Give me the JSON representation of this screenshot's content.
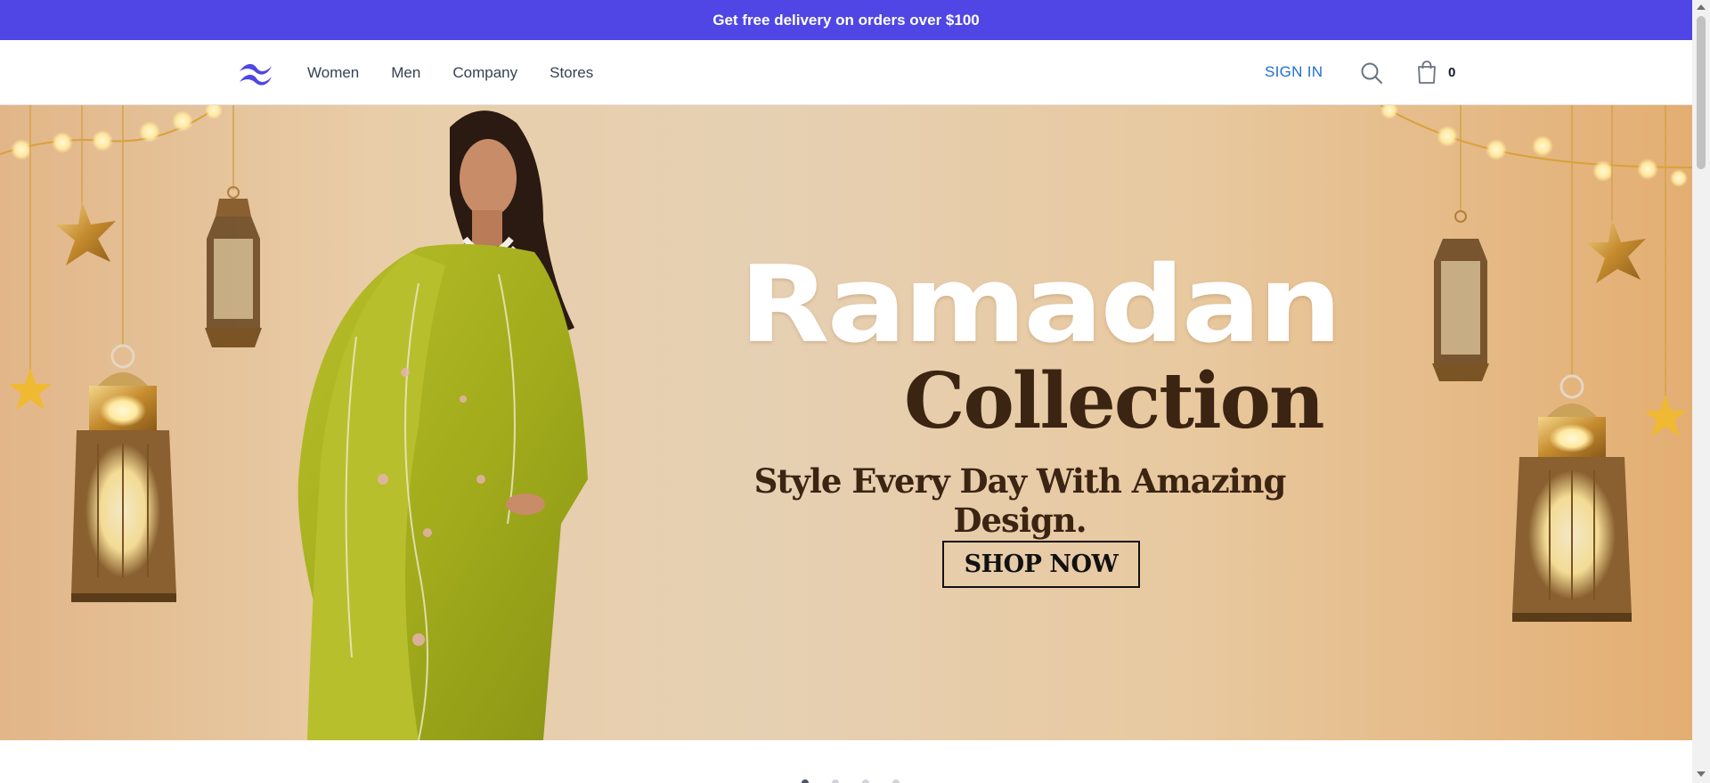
{
  "announcement": {
    "text": "Get free delivery on orders over $100"
  },
  "nav": {
    "logo": "wave-logo-icon",
    "links": [
      "Women",
      "Men",
      "Company",
      "Stores"
    ],
    "signin_label": "SIGN IN",
    "search_icon": "search-icon",
    "cart_icon": "shopping-bag-icon",
    "cart_count": "0"
  },
  "hero": {
    "title_line1": "Ramadan",
    "title_line2": "Collection",
    "tagline": "Style Every Day With Amazing Design.",
    "cta_label": "SHOP NOW"
  },
  "carousel": {
    "slides": 4,
    "active_index": 0
  },
  "colors": {
    "announcement_bg": "#4f46e5",
    "signin_link": "#1f6fcf",
    "hero_text_dark": "#3b2412",
    "dress_green": "#a3ad1c"
  }
}
